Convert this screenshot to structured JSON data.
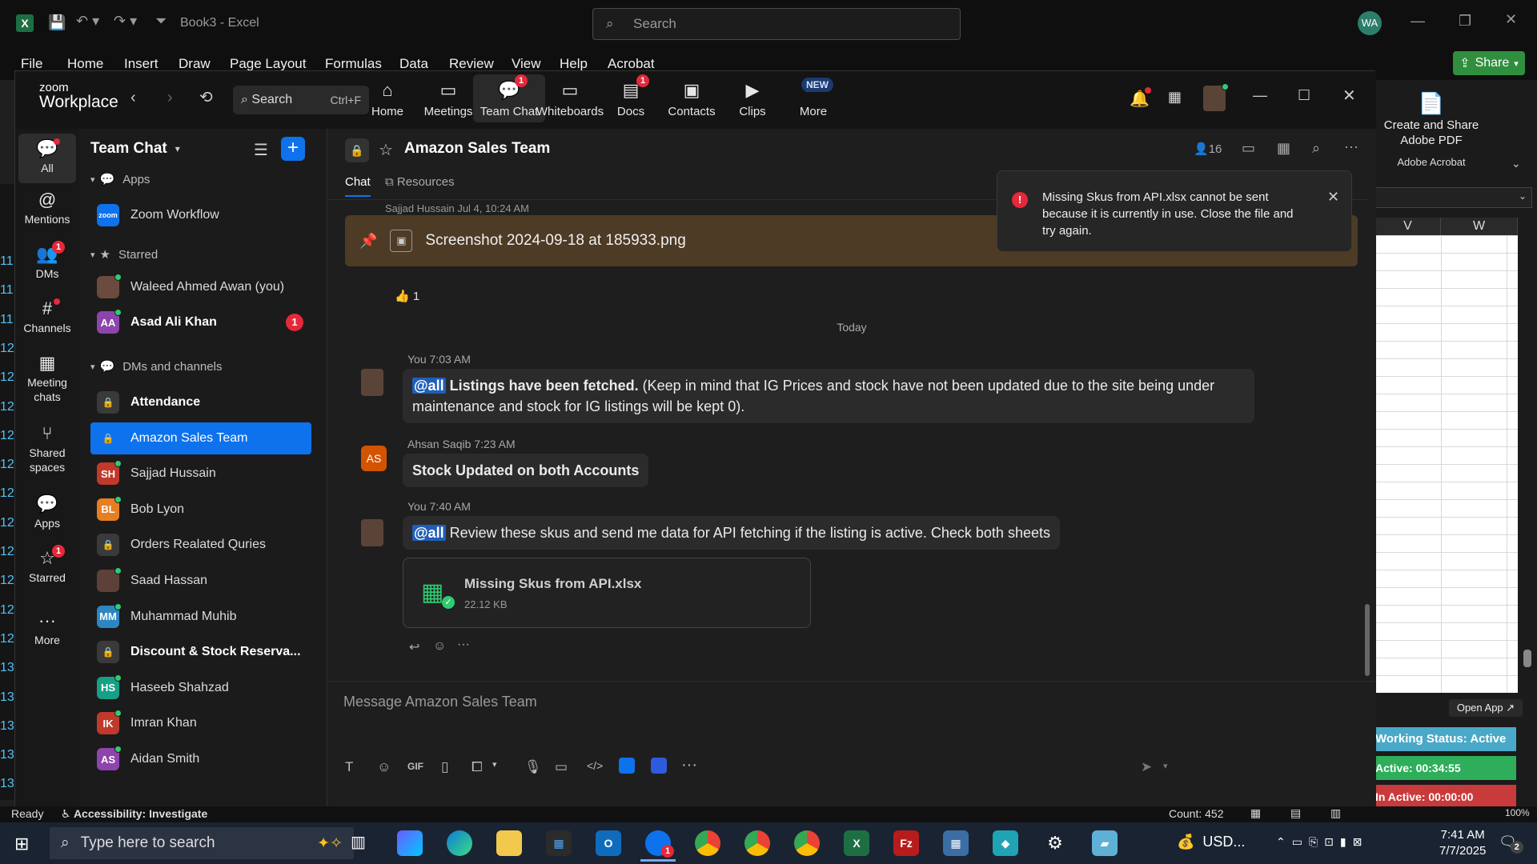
{
  "excel": {
    "doc_title": "Book3",
    "app_name": "Excel",
    "search_placeholder": "Search",
    "user_initials": "WA",
    "share_label": "Share",
    "tabs": [
      "File",
      "Home",
      "Insert",
      "Draw",
      "Page Layout",
      "Formulas",
      "Data",
      "Review",
      "View",
      "Help",
      "Acrobat"
    ],
    "acrobat_panel": {
      "title": "Create and Share Adobe PDF",
      "group": "Adobe Acrobat"
    },
    "columns": [
      "V",
      "W"
    ],
    "row_numbers": [
      "11",
      "11",
      "11",
      "12",
      "12",
      "12",
      "12",
      "12",
      "12",
      "12",
      "12",
      "12",
      "12",
      "12",
      "13",
      "13",
      "13",
      "13",
      "13",
      "13",
      "13"
    ],
    "status": {
      "ready": "Ready",
      "accessibility": "Accessibility: Investigate",
      "count": "Count: 452",
      "zoom": "100%"
    }
  },
  "zoom": {
    "brand_line1": "zoom",
    "brand_line2": "Workplace",
    "search_label": "Search",
    "search_shortcut": "Ctrl+F",
    "nav": [
      {
        "label": "Home",
        "badge": ""
      },
      {
        "label": "Meetings",
        "badge": ""
      },
      {
        "label": "Team Chat",
        "badge": "1"
      },
      {
        "label": "Whiteboards",
        "badge": ""
      },
      {
        "label": "Docs",
        "badge": "1"
      },
      {
        "label": "Contacts",
        "badge": ""
      },
      {
        "label": "Clips",
        "badge": ""
      },
      {
        "label": "More",
        "badge": "NEW"
      }
    ],
    "rail": [
      {
        "label": "All",
        "badge": ""
      },
      {
        "label": "Mentions",
        "badge": ""
      },
      {
        "label": "DMs",
        "badge": "1"
      },
      {
        "label": "Channels",
        "badge": ""
      },
      {
        "label": "Meeting chats",
        "badge": ""
      },
      {
        "label": "Shared spaces",
        "badge": ""
      },
      {
        "label": "Apps",
        "badge": ""
      },
      {
        "label": "Starred",
        "badge": "1"
      },
      {
        "label": "More",
        "badge": ""
      }
    ],
    "sidebar": {
      "title": "Team Chat",
      "sections": {
        "apps": "Apps",
        "starred": "Starred",
        "dms": "DMs and channels"
      },
      "apps_items": [
        {
          "label": "Zoom Workflow",
          "avatar": "zoom",
          "color": "#0e72ed"
        }
      ],
      "starred_items": [
        {
          "label": "Waleed Ahmed Awan (you)",
          "avatar": "",
          "color": "#6b4b3e",
          "bold": false,
          "badge": ""
        },
        {
          "label": "Asad Ali Khan",
          "avatar": "AA",
          "color": "#8e44ad",
          "bold": true,
          "badge": "1"
        }
      ],
      "dm_items": [
        {
          "label": "Attendance",
          "avatar": "lock",
          "color": "#3a3a3a",
          "bold": true
        },
        {
          "label": "Amazon Sales Team",
          "avatar": "lock",
          "color": "#0e72ed",
          "bold": false,
          "active": true
        },
        {
          "label": "Sajjad Hussain",
          "avatar": "SH",
          "color": "#c0392b",
          "bold": false
        },
        {
          "label": "Bob Lyon",
          "avatar": "BL",
          "color": "#e67e22",
          "bold": false
        },
        {
          "label": "Orders Realated Quries",
          "avatar": "lock",
          "color": "#3a3a3a",
          "bold": false
        },
        {
          "label": "Saad Hassan",
          "avatar": "",
          "color": "#5d4037",
          "bold": false
        },
        {
          "label": "Muhammad Muhib",
          "avatar": "MM",
          "color": "#2e86c1",
          "bold": false
        },
        {
          "label": "Discount & Stock Reserva...",
          "avatar": "lock",
          "color": "#3a3a3a",
          "bold": true
        },
        {
          "label": "Haseeb Shahzad",
          "avatar": "HS",
          "color": "#16a085",
          "bold": false
        },
        {
          "label": "Imran Khan",
          "avatar": "IK",
          "color": "#c0392b",
          "bold": false
        },
        {
          "label": "Aidan Smith",
          "avatar": "AS",
          "color": "#8e44ad",
          "bold": false
        }
      ]
    },
    "channel": {
      "name": "Amazon Sales Team",
      "member_count": "16",
      "tabs": [
        "Chat",
        "Resources"
      ],
      "pinned": "Screenshot 2024-09-18 at 185933.png",
      "pinned_meta": "Sajjad Hussain Jul 4, 10:24 AM",
      "reaction": "1",
      "divider": "Today",
      "messages": [
        {
          "author": "You",
          "time": "7:03 AM",
          "mention": "@all",
          "bold": "Listings have been fetched.",
          "text": " (Keep in mind that IG Prices and stock have not been updated due to the site being under maintenance and stock for IG listings will be kept 0)."
        },
        {
          "author": "Ahsan Saqib",
          "time": "7:23 AM",
          "avatar": "AS",
          "bold": "Stock Updated on both Accounts"
        },
        {
          "author": "You",
          "time": "7:40 AM",
          "mention": "@all",
          "text": " Review these skus and send me data for API fetching if the listing is active. Check both sheets",
          "file_name": "Missing Skus from API.xlsx",
          "file_size": "22.12 KB"
        }
      ],
      "composer_placeholder": "Message Amazon Sales Team"
    },
    "toast": "Missing Skus from API.xlsx cannot be sent because it is currently in use. Close the file and try again."
  },
  "overlay": {
    "open_app": "Open App",
    "working_status": "Working Status: Active",
    "active": "Active: 00:34:55",
    "inactive": "In Active: 00:00:00"
  },
  "taskbar": {
    "search_placeholder": "Type here to search",
    "currency": "USD...",
    "time": "7:41 AM",
    "date": "7/7/2025",
    "notif_count": "2"
  }
}
